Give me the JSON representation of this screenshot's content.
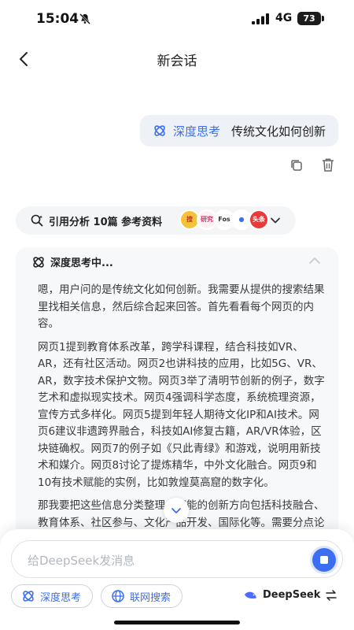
{
  "status_bar": {
    "time": "15:04",
    "network": "4G",
    "battery": "73"
  },
  "nav": {
    "title": "新会话"
  },
  "user_message": {
    "tag": "深度思考",
    "text": "传统文化如何创新"
  },
  "citations": {
    "label": "引用分析 10篇 参考资料",
    "thumbs": [
      {
        "text": "搜",
        "bg": "#f5c23a",
        "fg": "#c0392b"
      },
      {
        "text": "研究",
        "bg": "#fff1f3",
        "fg": "#d6336c"
      },
      {
        "text": "Fos",
        "bg": "#ffffff",
        "fg": "#333333"
      },
      {
        "text": "●",
        "bg": "#ffffff",
        "fg": "#3b6ef0"
      },
      {
        "text": "头条",
        "bg": "#e83a3a",
        "fg": "#ffffff"
      }
    ]
  },
  "thinking": {
    "title": "深度思考中...",
    "paragraphs": [
      "嗯，用户问的是传统文化如何创新。我需要从提供的搜索结果里找相关信息，然后综合起来回答。首先看看每个网页的内容。",
      "网页1提到教育体系改革，跨学科课程，结合科技如VR、AR，还有社区活动。网页2也讲科技的应用，比如5G、VR、AR，数字技术保护文物。网页3举了清明节创新的例子，数字艺术和虚拟现实技术。网页4强调科学态度，系统梳理资源，宣传方式多样化。网页5提到年轻人期待文化IP和AI技术。网页6建议非遗跨界融合，科技如AI修复古籍，AR/VR体验，区块链确权。网页7的例子如《只此青绿》和游戏，说明用新技术和媒介。网页8讨论了提炼精华，中外文化融合。网页9和10有技术赋能的实例，比如敦煌莫高窟的数字化。",
      "那我要把这些信息分类整理，可能的创新方向包括科技融合、教育体系、社区参与、文化产品开发、国际化等。需要分点论述，每个点结合多个网页的引用，比如科技融合"
    ]
  },
  "composer": {
    "placeholder": "给DeepSeek发消息",
    "chip_think": "深度思考",
    "chip_search": "联网搜索",
    "model": "DeepSeek"
  },
  "colors": {
    "accent": "#3b6ef0",
    "bubble": "#eef1f6",
    "panel": "#f7f8fa"
  }
}
